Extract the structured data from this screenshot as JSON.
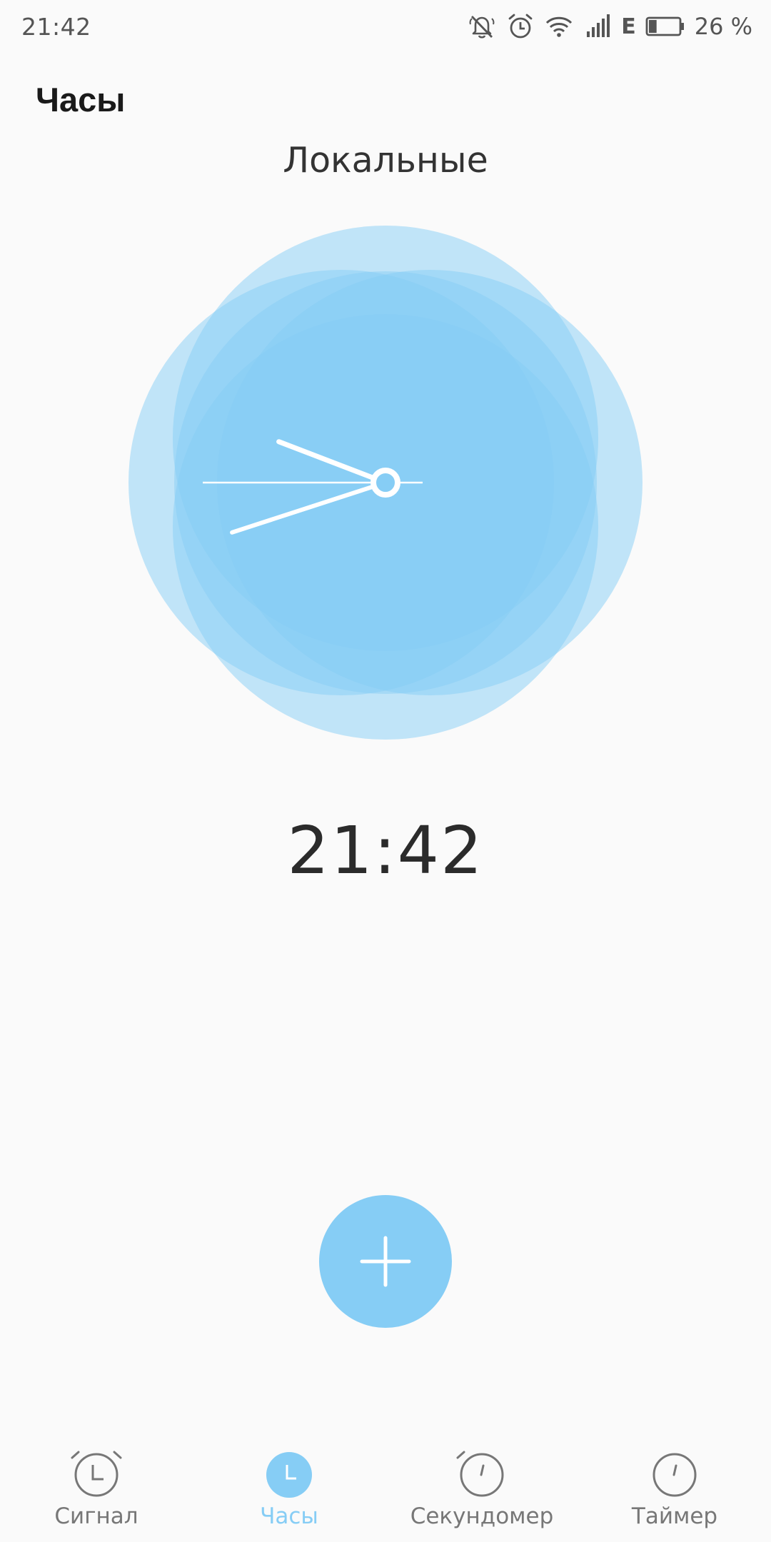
{
  "status_bar": {
    "time": "21:42",
    "icons": [
      "bell-off-icon",
      "alarm-icon",
      "wifi-icon",
      "signal-icon"
    ],
    "network_type": "E",
    "battery_percent_label": "26 %",
    "battery_level": 0.26
  },
  "header": {
    "app_title": "Часы",
    "section_title": "Локальные"
  },
  "clock": {
    "digital_time": "21:42",
    "hours": 21,
    "minutes": 42,
    "accent_color": "#86cdf5"
  },
  "fab": {
    "icon": "plus-icon",
    "color": "#86cdf5"
  },
  "bottom_nav": {
    "active_index": 1,
    "active_color": "#86cdf5",
    "inactive_color": "#777777",
    "items": [
      {
        "label": "Сигнал",
        "icon": "alarm-clock-icon"
      },
      {
        "label": "Часы",
        "icon": "clock-icon"
      },
      {
        "label": "Секундомер",
        "icon": "stopwatch-icon"
      },
      {
        "label": "Таймер",
        "icon": "timer-icon"
      }
    ]
  }
}
